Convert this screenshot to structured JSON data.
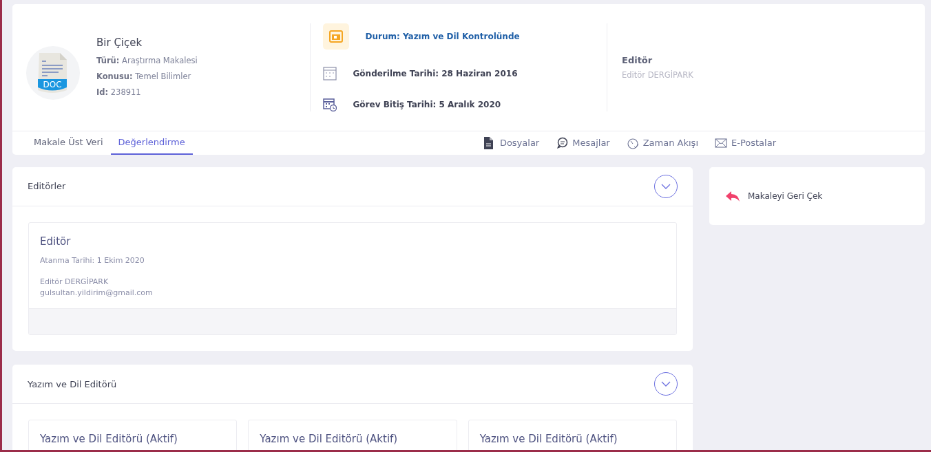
{
  "article": {
    "title": "Bir Çiçek",
    "fields": [
      {
        "label": "Türü:",
        "value": "Araştırma Makalesi"
      },
      {
        "label": "Konusu:",
        "value": "Temel Bilimler"
      },
      {
        "label": "Id:",
        "value": "238911"
      }
    ]
  },
  "icon_label": "DOC",
  "status": {
    "text": "Durum: Yazım ve Dil Kontrolünde"
  },
  "dates": [
    {
      "kind": "calendar",
      "text": "Gönderilme Tarihi: 28 Haziran 2016"
    },
    {
      "kind": "deadline",
      "text": "Görev Bitiş Tarihi: 5 Aralık 2020"
    }
  ],
  "editor": {
    "role": "Editör",
    "name": "Editör DERGİPARK"
  },
  "tabs": [
    {
      "label": "Makale Üst Veri",
      "selected": false
    },
    {
      "label": "Değerlendirme",
      "selected": true
    }
  ],
  "links": [
    {
      "kind": "file",
      "label": "Dosyalar"
    },
    {
      "kind": "chat",
      "label": "Mesajlar"
    },
    {
      "kind": "clock",
      "label": "Zaman Akışı"
    },
    {
      "kind": "mail",
      "label": "E-Postalar"
    }
  ],
  "sections": [
    {
      "title": "Editörler",
      "cards": [
        {
          "title": "Editör",
          "assigned": "Atanma Tarihi: 1 Ekim 2020",
          "name": "Editör DERGİPARK",
          "email": "gulsultan.yildirim@gmail.com"
        }
      ]
    },
    {
      "title": "Yazım ve Dil Editörü",
      "cards": [
        {
          "title": "Yazım ve Dil Editörü (Aktif)"
        },
        {
          "title": "Yazım ve Dil Editörü (Aktif)"
        },
        {
          "title": "Yazım ve Dil Editörü (Aktif)"
        }
      ]
    }
  ],
  "actions": [
    {
      "label": "Makaleyi Geri Çek"
    }
  ]
}
